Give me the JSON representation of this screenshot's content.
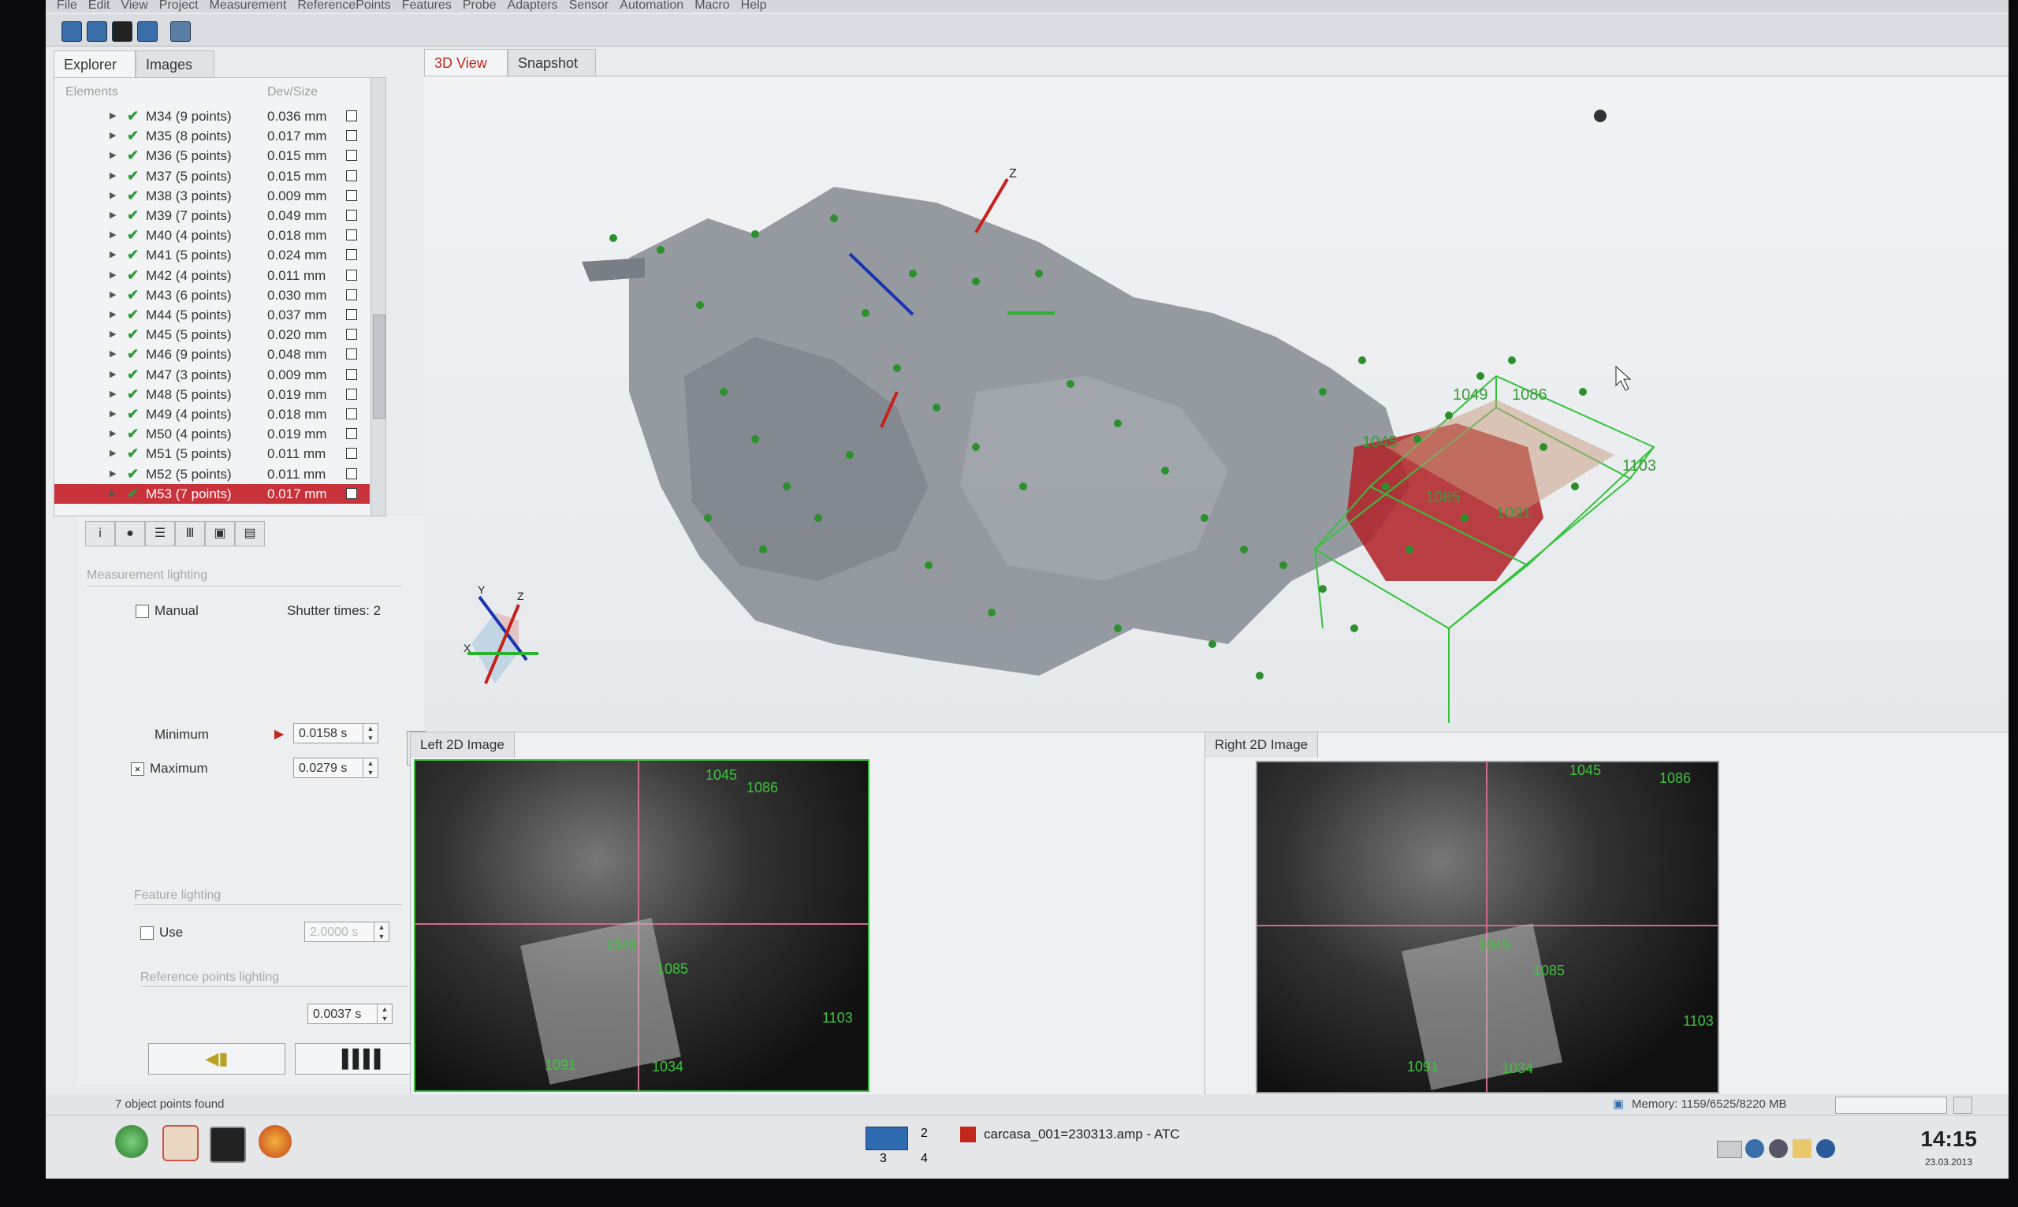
{
  "menu": [
    "File",
    "Edit",
    "View",
    "Project",
    "Measurement",
    "ReferencePoints",
    "Features",
    "Probe",
    "Adapters",
    "Sensor",
    "Automation",
    "Macro",
    "Help"
  ],
  "left_tabs": {
    "explorer": "Explorer",
    "images": "Images"
  },
  "explorer": {
    "col_elements": "Elements",
    "col_devsize": "Dev/Size",
    "items": [
      {
        "name": "M34  (9 points)",
        "val": "0.036 mm"
      },
      {
        "name": "M35  (8 points)",
        "val": "0.017 mm"
      },
      {
        "name": "M36  (5 points)",
        "val": "0.015 mm"
      },
      {
        "name": "M37  (5 points)",
        "val": "0.015 mm"
      },
      {
        "name": "M38  (3 points)",
        "val": "0.009 mm"
      },
      {
        "name": "M39  (7 points)",
        "val": "0.049 mm"
      },
      {
        "name": "M40  (4 points)",
        "val": "0.018 mm"
      },
      {
        "name": "M41  (5 points)",
        "val": "0.024 mm"
      },
      {
        "name": "M42  (4 points)",
        "val": "0.011 mm"
      },
      {
        "name": "M43  (6 points)",
        "val": "0.030 mm"
      },
      {
        "name": "M44  (5 points)",
        "val": "0.037 mm"
      },
      {
        "name": "M45  (5 points)",
        "val": "0.020 mm"
      },
      {
        "name": "M46  (9 points)",
        "val": "0.048 mm"
      },
      {
        "name": "M47  (3 points)",
        "val": "0.009 mm"
      },
      {
        "name": "M48  (5 points)",
        "val": "0.019 mm"
      },
      {
        "name": "M49  (4 points)",
        "val": "0.018 mm"
      },
      {
        "name": "M50  (4 points)",
        "val": "0.019 mm"
      },
      {
        "name": "M51  (5 points)",
        "val": "0.011 mm"
      },
      {
        "name": "M52  (5 points)",
        "val": "0.011 mm"
      },
      {
        "name": "M53  (7 points)",
        "val": "0.017 mm"
      }
    ]
  },
  "settings": {
    "measurement_lighting": "Measurement lighting",
    "manual": "Manual",
    "shutter_times": "Shutter times: 2",
    "minimum": "Minimum",
    "minimum_value": "0.0158 s",
    "maximum": "Maximum",
    "maximum_value": "0.0279 s",
    "feature_lighting": "Feature lighting",
    "use": "Use",
    "use_value": "2.0000 s",
    "reference_points_lighting": "Reference points lighting",
    "ref_value": "0.0037 s"
  },
  "view_tabs": {
    "view3d": "3D View",
    "snapshot": "Snapshot"
  },
  "view3d": {
    "axis_z": "Z",
    "triad_x": "X",
    "triad_y": "Y",
    "triad_z": "Z",
    "labels": [
      "1086",
      "1103",
      "1085",
      "1045",
      "1049",
      "1091"
    ]
  },
  "left_image": {
    "title": "Left 2D Image",
    "labels": [
      "1045",
      "1086",
      "1049",
      "1085",
      "1103",
      "1091",
      "1034"
    ]
  },
  "right_image": {
    "title": "Right 2D Image",
    "labels": [
      "1045",
      "1086",
      "1049",
      "1085",
      "1103",
      "1091",
      "1034"
    ]
  },
  "status": {
    "found": "7 object points found",
    "memory": "Memory: 1159/6525/8220 MB"
  },
  "taskbar": {
    "workspaces": [
      "2",
      "3",
      "4"
    ],
    "active_window": "carcasa_001=230313.amp - ATC",
    "time": "14:15",
    "date": "23.03.2013"
  },
  "colors": {
    "selection": "#c9323a",
    "green_marker": "#2d8f2d",
    "accent_red": "#c0281e"
  }
}
